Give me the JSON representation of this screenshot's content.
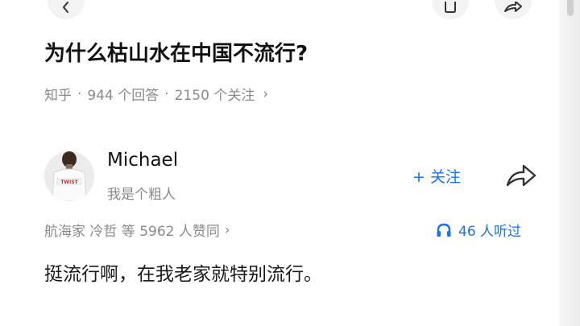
{
  "question": {
    "title": "为什么枯山水在中国不流行?",
    "source": "知乎",
    "answers_count": "944 个回答",
    "followers_count": "2150 个关注",
    "chevron": "›"
  },
  "author": {
    "name": "Michael",
    "bio": "我是个粗人",
    "follow_label": "+ 关注",
    "shirt_text": "TWIST"
  },
  "endorse": {
    "text": "航海家 冷哲 等 5962 人赞同",
    "chevron": "›"
  },
  "listen": {
    "text": "46 人听过"
  },
  "answer": {
    "text": "挺流行啊，在我老家就特别流行。"
  },
  "colors": {
    "accent": "#1772f6",
    "muted": "#8a8a8a",
    "text": "#121212"
  },
  "icons": {
    "back": "chevron-left-icon",
    "bookmark": "bookmark-icon",
    "share_top": "share-icon",
    "share": "share-arrow-icon",
    "headphones": "headphones-icon"
  }
}
